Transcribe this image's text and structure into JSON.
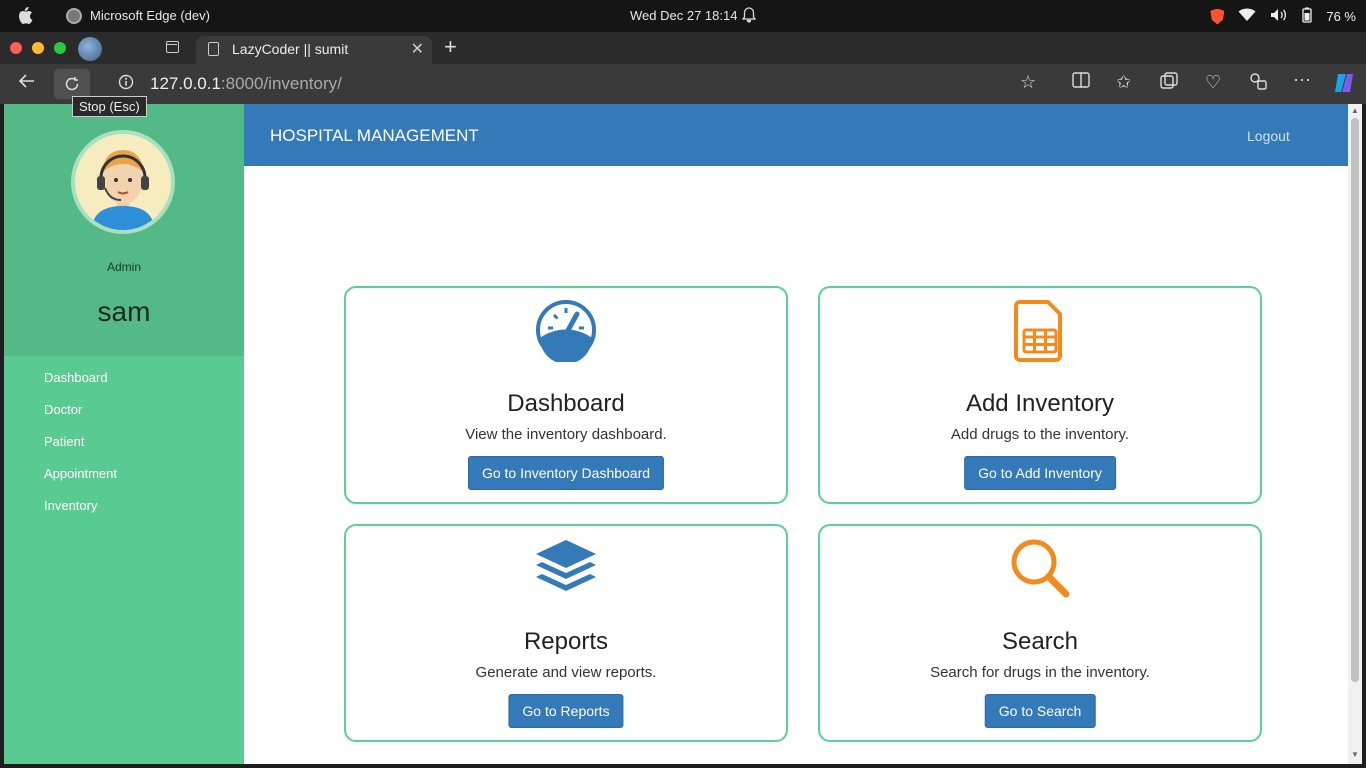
{
  "system_bar": {
    "app_name": "Microsoft Edge (dev)",
    "clock": "Wed Dec 27   18:14",
    "battery": "76 %"
  },
  "browser": {
    "tab_title": "LazyCoder || sumit",
    "url_host": "127.0.0.1",
    "url_rest": ":8000/inventory/",
    "tooltip": "Stop (Esc)"
  },
  "sidebar": {
    "role": "Admin",
    "username": "sam",
    "items": [
      {
        "label": "Dashboard"
      },
      {
        "label": "Doctor"
      },
      {
        "label": "Patient"
      },
      {
        "label": "Appointment"
      },
      {
        "label": "Inventory"
      }
    ]
  },
  "header": {
    "brand": "HOSPITAL MANAGEMENT",
    "logout": "Logout"
  },
  "cards": [
    {
      "title": "Dashboard",
      "desc": "View the inventory dashboard.",
      "button": "Go to Inventory Dashboard",
      "icon": "gauge-icon",
      "color": "#3479b8"
    },
    {
      "title": "Add Inventory",
      "desc": "Add drugs to the inventory.",
      "button": "Go to Add Inventory",
      "icon": "sim-card-icon",
      "color": "#f28a1e"
    },
    {
      "title": "Reports",
      "desc": "Generate and view reports.",
      "button": "Go to Reports",
      "icon": "layers-icon",
      "color": "#3479b8"
    },
    {
      "title": "Search",
      "desc": "Search for drugs in the inventory.",
      "button": "Go to Search",
      "icon": "search-icon",
      "color": "#f28a1e"
    }
  ]
}
